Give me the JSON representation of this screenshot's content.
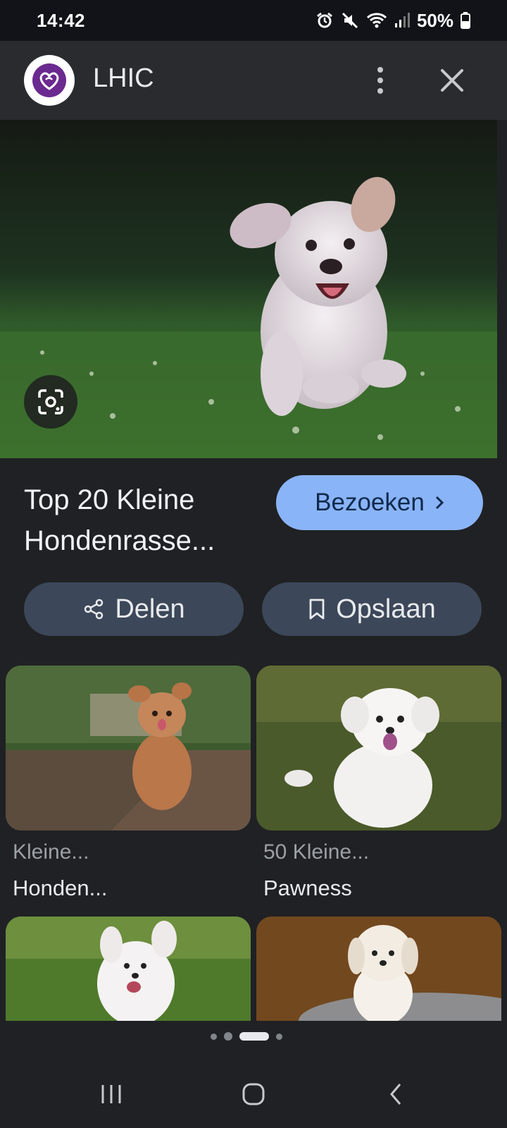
{
  "status": {
    "time": "14:42",
    "battery": "50%"
  },
  "header": {
    "title": "LHIC",
    "more_icon": "more-vert-icon",
    "close_icon": "close-icon"
  },
  "result": {
    "title_line1": "Top 20 Kleine",
    "title_line2": "Hondenrasse...",
    "visit_label": "Bezoeken",
    "share_label": "Delen",
    "save_label": "Opslaan"
  },
  "related": [
    {
      "source": "Kleine...",
      "title": "Honden..."
    },
    {
      "source": "50 Kleine...",
      "title": "Pawness"
    }
  ],
  "colors": {
    "accent": "#8ab4f8",
    "button_bg": "#3c4759",
    "background": "#202124"
  }
}
